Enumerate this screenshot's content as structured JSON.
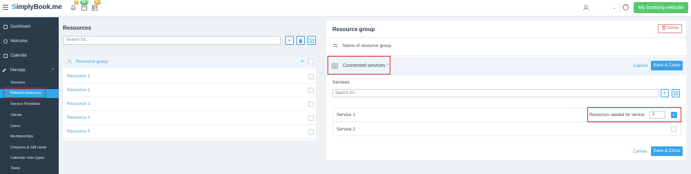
{
  "topbar": {
    "logo_prefix": "S",
    "logo_rest": "implyBook",
    "logo_suffix": ".me",
    "badges": [
      "5",
      "30+",
      "3+"
    ],
    "my_booking_label": "My booking website",
    "help_label": "?"
  },
  "sidebar": {
    "items": [
      {
        "label": "Dashboard",
        "icon": "dashboard-icon"
      },
      {
        "label": "Welcome",
        "icon": "welcome-icon"
      },
      {
        "label": "Calendar",
        "icon": "calendar-icon"
      },
      {
        "label": "Manage",
        "icon": "manage-icon"
      }
    ],
    "subitems": [
      "Services",
      "Related resources",
      "Service Providers",
      "Clients",
      "Users",
      "Memberships",
      "Coupons & Gift cards",
      "Calendar note types",
      "Taxes"
    ],
    "active_subitem": "Related resources"
  },
  "resources": {
    "title": "Resources",
    "search_placeholder": "Search for...",
    "group_label": "Resource group",
    "group_plus": "+",
    "items": [
      "Resource 1",
      "Resource 2",
      "Resource 3",
      "Resource 4",
      "Resource 5"
    ]
  },
  "resource_group": {
    "title": "Resource group",
    "delete_label": "Delete",
    "name_placeholder": "Name of resource group",
    "connected_label": "Connected services",
    "connected_star": "*",
    "cancel_label": "Cancel",
    "save_close_label": "Save & Close",
    "services_title": "Services",
    "services_search_placeholder": "Search for...",
    "services": [
      {
        "name": "Service 1",
        "checked": true
      },
      {
        "name": "Service 2",
        "checked": false
      }
    ],
    "needed_label": "Resources needed for service",
    "needed_value": "2",
    "checkmark": "✓"
  },
  "colors": {
    "accent": "#3aa3e8",
    "sidebar_bg": "#2a3b4c",
    "green": "#56c86e",
    "highlight": "#e0262a"
  }
}
